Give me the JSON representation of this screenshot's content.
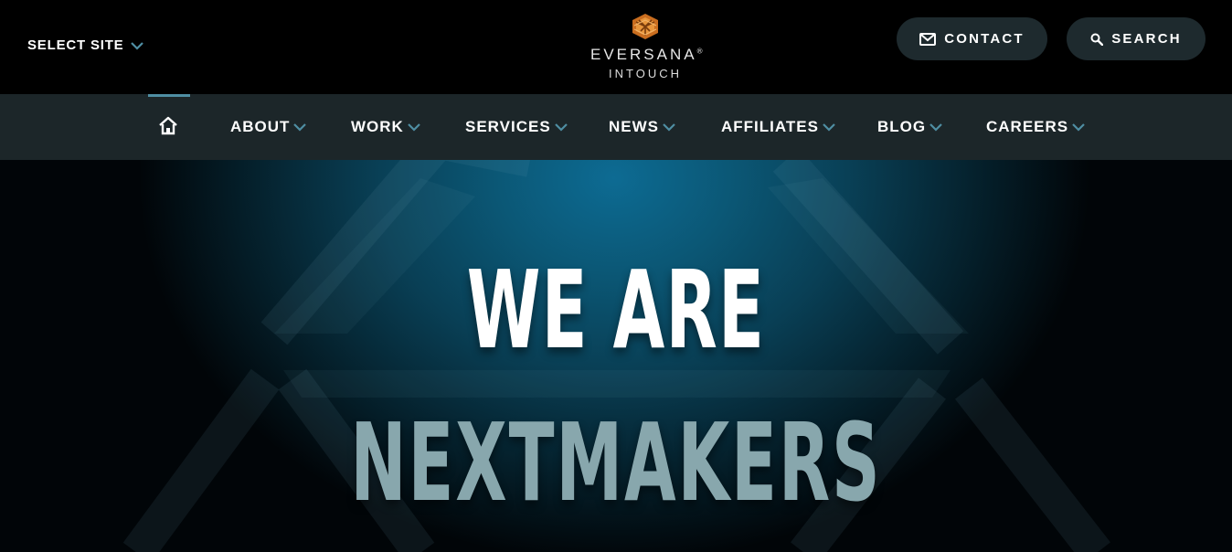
{
  "header": {
    "select_site": "SELECT SITE",
    "logo": {
      "brand": "EVERSANA",
      "trademark": "®",
      "sub": "INTOUCH",
      "mark_icon": "hexagon-knot-logo"
    },
    "contact_label": "CONTACT",
    "search_label": "SEARCH"
  },
  "nav": {
    "home_icon": "home-icon",
    "items": [
      {
        "label": "ABOUT"
      },
      {
        "label": "WORK"
      },
      {
        "label": "SERVICES"
      },
      {
        "label": "NEWS"
      },
      {
        "label": "AFFILIATES"
      },
      {
        "label": "BLOG"
      },
      {
        "label": "CAREERS"
      }
    ]
  },
  "hero": {
    "line1": "WE ARE",
    "line2": "NEXTMAKERS"
  },
  "colors": {
    "accent": "#4f8ea3",
    "nav_bg": "#1c2629",
    "pill_bg": "#1e2a2e",
    "logo_orange": "#d9822b",
    "headline_secondary": "#88a7ad"
  }
}
